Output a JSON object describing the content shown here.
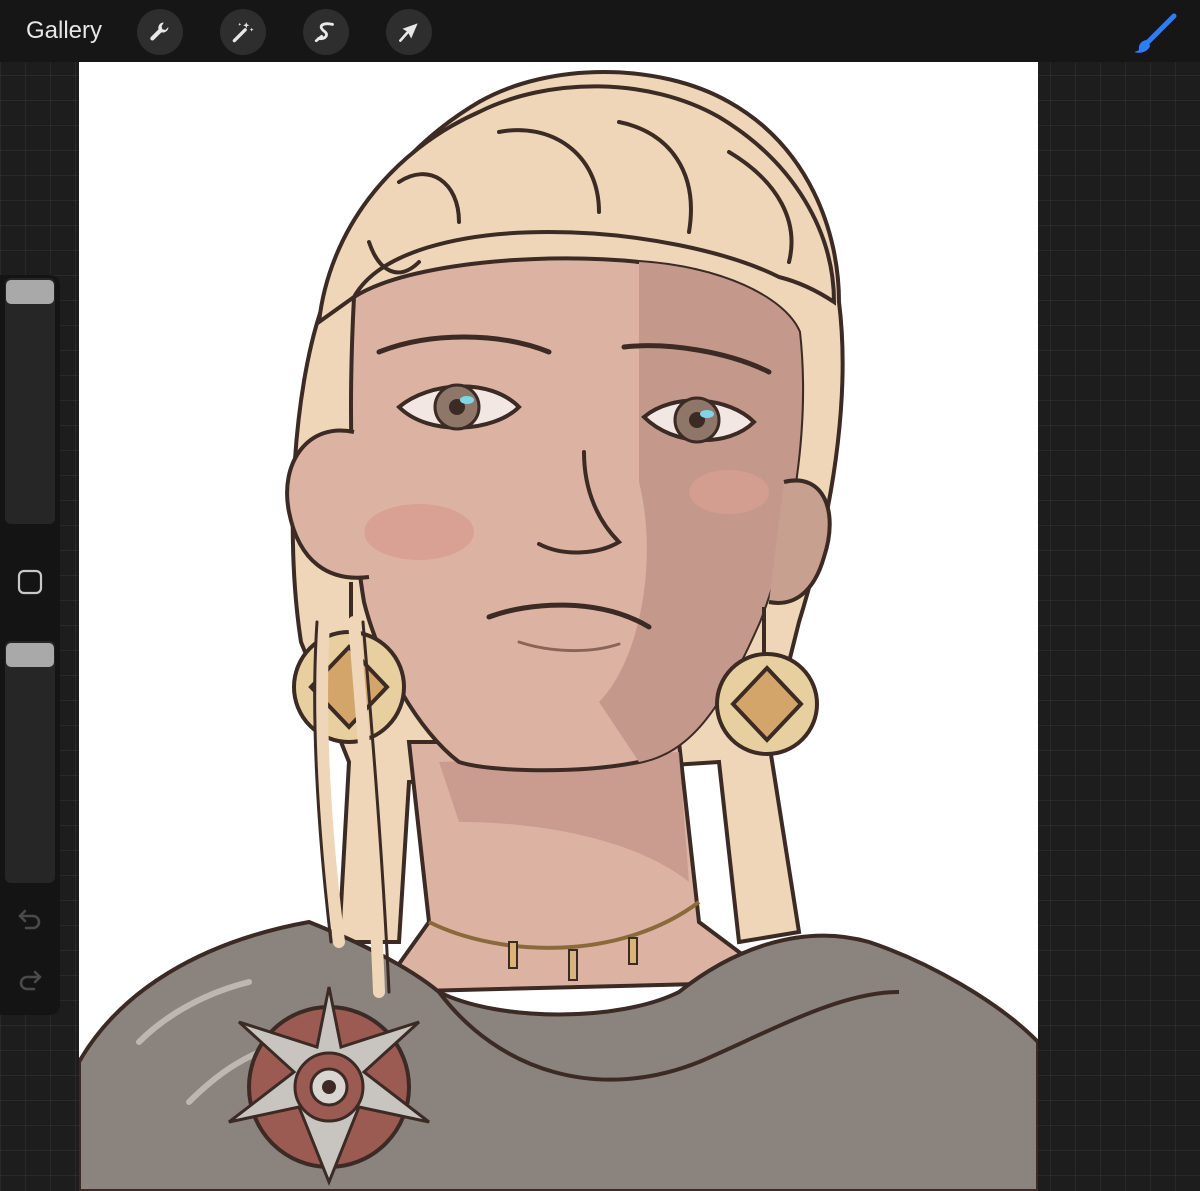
{
  "toolbar": {
    "gallery_label": "Gallery",
    "tools": [
      {
        "name": "actions",
        "icon": "wrench-icon"
      },
      {
        "name": "adjustments",
        "icon": "magic-wand-icon"
      },
      {
        "name": "selection",
        "icon": "selection-s-icon"
      },
      {
        "name": "transform",
        "icon": "arrow-cursor-icon"
      }
    ],
    "active_tool": {
      "name": "brush",
      "icon": "paintbrush-icon",
      "color": "#2f7df6"
    }
  },
  "sidebar": {
    "brush_size_level": 1.0,
    "opacity_level": 1.0,
    "modify_icon": "square-icon",
    "undo_icon": "undo-icon",
    "redo_icon": "redo-icon"
  },
  "canvas": {
    "background": "#ffffff",
    "artwork": "character-portrait"
  },
  "colors": {
    "ui_dark": "#161616",
    "slider_thumb": "#a9a9a9",
    "accent": "#2f7df6"
  }
}
